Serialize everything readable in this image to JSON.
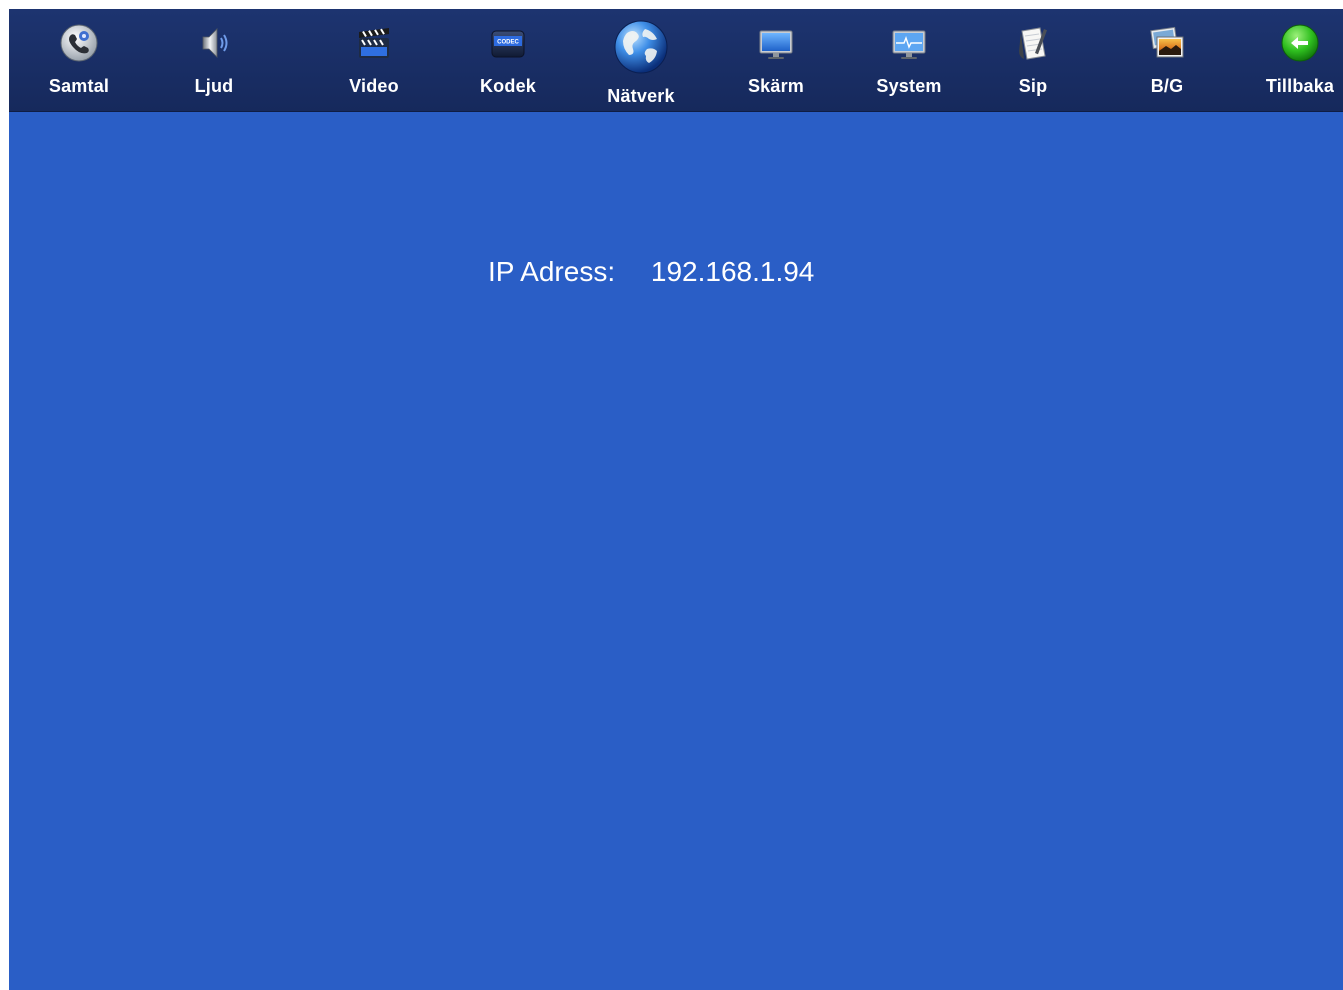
{
  "colors": {
    "topbar": "#1a2f66",
    "background": "#2a5ec6",
    "text": "#ffffff"
  },
  "nav": {
    "items": [
      {
        "label": "Samtal",
        "icon": "phone-settings-icon"
      },
      {
        "label": "Ljud",
        "icon": "speaker-icon"
      },
      {
        "label": "Video",
        "icon": "clapperboard-icon"
      },
      {
        "label": "Kodek",
        "icon": "codec-icon",
        "icon_text": "CODEC"
      },
      {
        "label": "Nätverk",
        "icon": "globe-icon",
        "active": true
      },
      {
        "label": "Skärm",
        "icon": "monitor-icon"
      },
      {
        "label": "System",
        "icon": "system-monitor-icon"
      },
      {
        "label": "Sip",
        "icon": "notepad-icon"
      },
      {
        "label": "B/G",
        "icon": "picture-icon"
      },
      {
        "label": "Tillbaka",
        "icon": "back-arrow-icon"
      }
    ]
  },
  "network": {
    "ip_label": "IP Adress:",
    "ip_value": "192.168.1.94"
  }
}
